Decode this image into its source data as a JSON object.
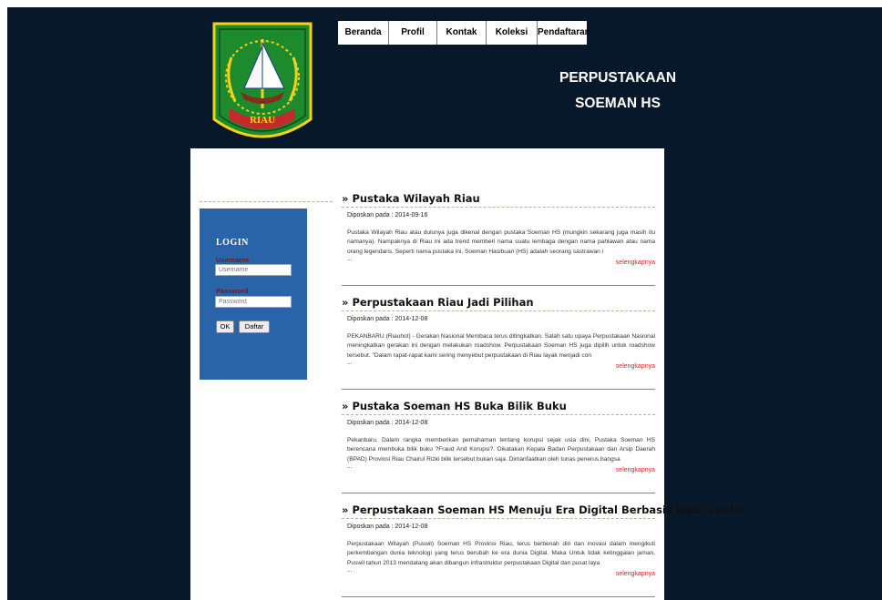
{
  "nav": [
    "Beranda",
    "Profil",
    "Kontak",
    "Koleksi",
    "Pendaftaran"
  ],
  "site_title": {
    "line1": "PERPUSTAKAAN",
    "line2": "SOEMAN HS"
  },
  "logo": {
    "text": "RIAU",
    "icon": "riau-province-emblem"
  },
  "login": {
    "title": "LOGIN",
    "username_label": "Username",
    "username_placeholder": "Username",
    "password_label": "Password",
    "password_placeholder": "Password",
    "ok_label": "OK",
    "register_label": "Daftar"
  },
  "posts": [
    {
      "title": "Pustaka Wilayah Riau",
      "date": "Diposkan pada : 2014-09-16",
      "body": "Pustaka Wilayah Riau atau dulunya juga dikenal dengan pustaka Soeman HS (mungkin sekarang juga masih itu namanya). Nampaknya di Riau ini ada trend memberi nama suatu lembaga dengan nama pahlawan atau nama orang legendaris. Seperti nama pustaka ini, Soeman Hasibuan (HS) adalah seorang sastrawan i",
      "more": "selengkapnya"
    },
    {
      "title": "Perpustakaan Riau Jadi Pilihan",
      "date": "Diposkan pada : 2014-12-08",
      "body": "PEKANBARU (Riauhot) - Gerakan Nasional Membaca terus ditingkatkan. Salah satu upaya Perpustakaan Nasional meningkatkan gerakan ini dengan melakukan roadshow. Perpustakaan Soeman HS juga dipilih untuk roadshow tersebut. \"Dalam rapat-rapat kami sering menyebut perpustakaan di Riau layak menjadi con",
      "more": "selengkapnya"
    },
    {
      "title": "Pustaka Soeman HS Buka Bilik Buku",
      "date": "Diposkan pada : 2014-12-08",
      "body": "Pekanbaru, Dalam rangka memberikan pemahaman tentang korupsi sejak usia dini, Pustaka Soeman HS berencana membuka bilik buku ?Fraud And Korupsi?. Dikatakan Kepala Badan Perpustakaan dan Arsip Daerah (BPAD) Provinsi Riau Chairul Rizki bilik tersebut bukan saja. Dimanfaatkan oleh tunas penerus bangsa",
      "more": "selengkapnya"
    },
    {
      "title": "Perpustakaan Soeman HS Menuju Era Digital Berbasis Data Center",
      "date": "Diposkan pada : 2014-12-08",
      "body": "Perpustakaan Wilayah (Puswil) Soeman HS Provinsi Riau, terus berbenah diri dan inovasi dalam mengikuti perkembangan dunia teknologi yang terus berubah ke era dunia Digital. Maka Untuk tidak ketinggalan jaman, Puswil tahun 2013 mendatang akan dibangun infrastruktur perpustakaan Digital dan pusat laya",
      "more": "selengkapnya"
    }
  ],
  "post_prefix": "»",
  "ellipsis": "...",
  "colors": {
    "background": "#07182b",
    "login_panel": "#2a64a8",
    "more_link": "#d42020",
    "label": "#8a1010"
  }
}
